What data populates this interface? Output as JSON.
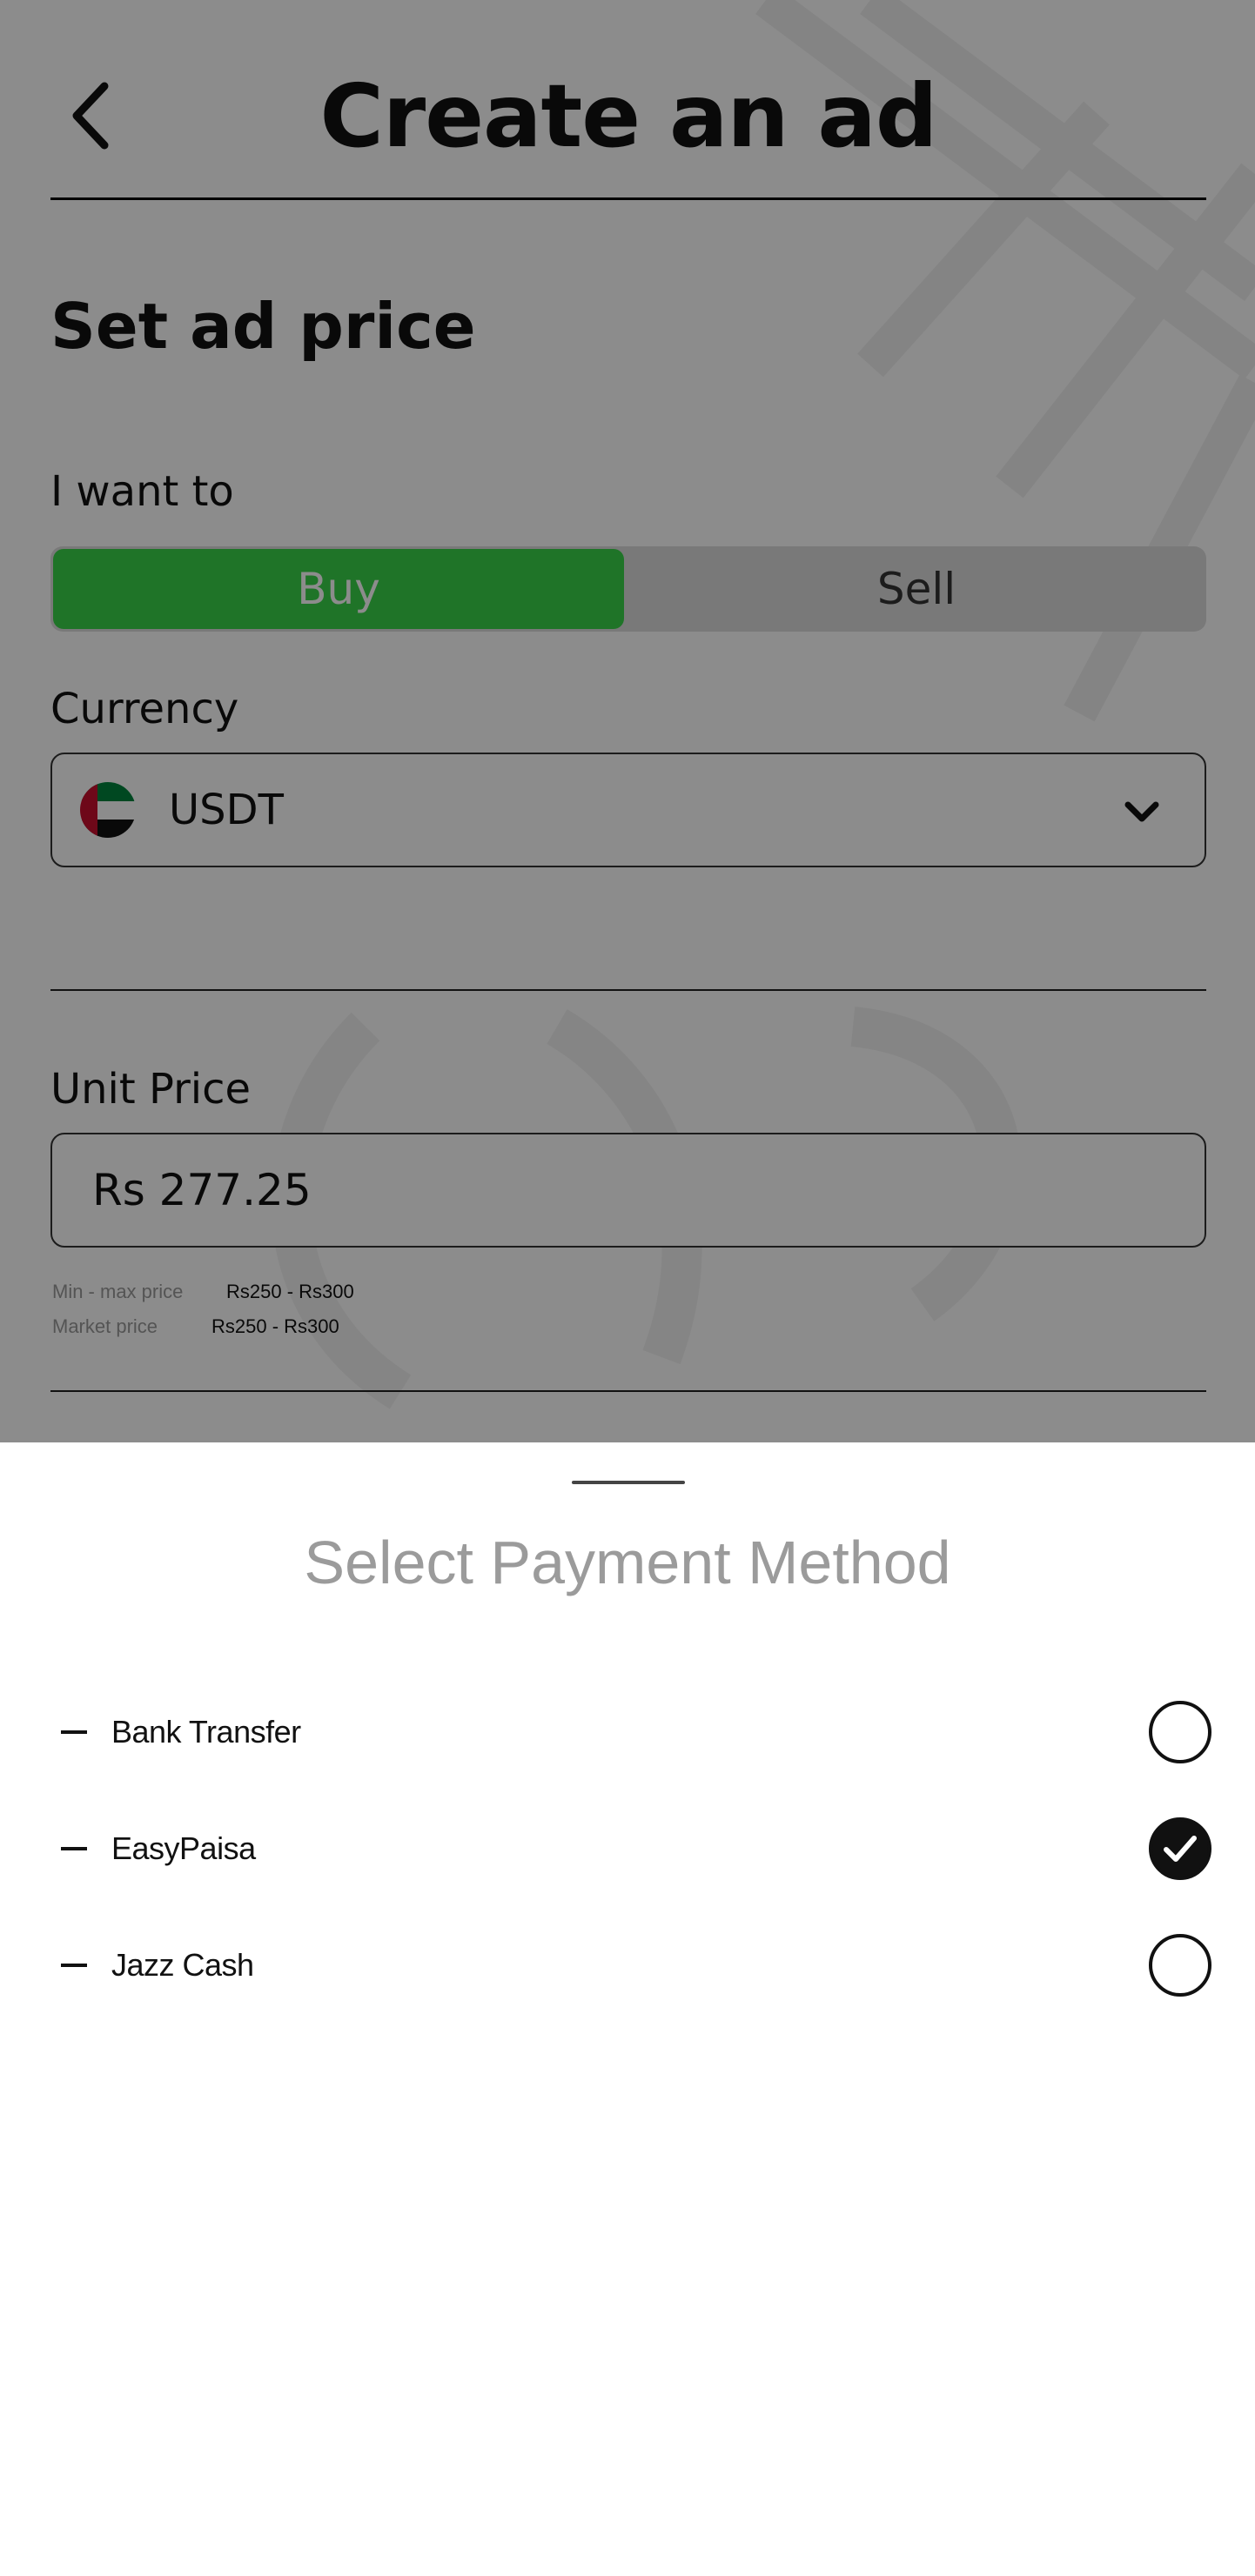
{
  "header": {
    "title": "Create an ad"
  },
  "form": {
    "section_title": "Set ad price",
    "want_label": "I want to",
    "buy_label": "Buy",
    "sell_label": "Sell",
    "selected_side": "Buy",
    "currency_label": "Currency",
    "currency_value": "USDT",
    "unit_price_label": "Unit Price",
    "unit_price_value": "Rs 277.25",
    "min_max_label": "Min - max price",
    "min_max_value": "Rs250 - Rs300",
    "market_label": "Market price",
    "market_value": "Rs250 - Rs300"
  },
  "sheet": {
    "title": "Select Payment Method",
    "methods": [
      {
        "label": "Bank Transfer",
        "selected": false
      },
      {
        "label": "EasyPaisa",
        "selected": true
      },
      {
        "label": "Jazz Cash",
        "selected": false
      }
    ]
  },
  "colors": {
    "accent_green": "#3ad44a",
    "overlay": "rgba(0,0,0,0.45)",
    "sheet_title": "#9b9b9b"
  },
  "icons": {
    "back": "chevron-left-icon",
    "dropdown": "chevron-down-icon",
    "flag": "uae-flag-icon",
    "check": "checkmark-icon"
  }
}
